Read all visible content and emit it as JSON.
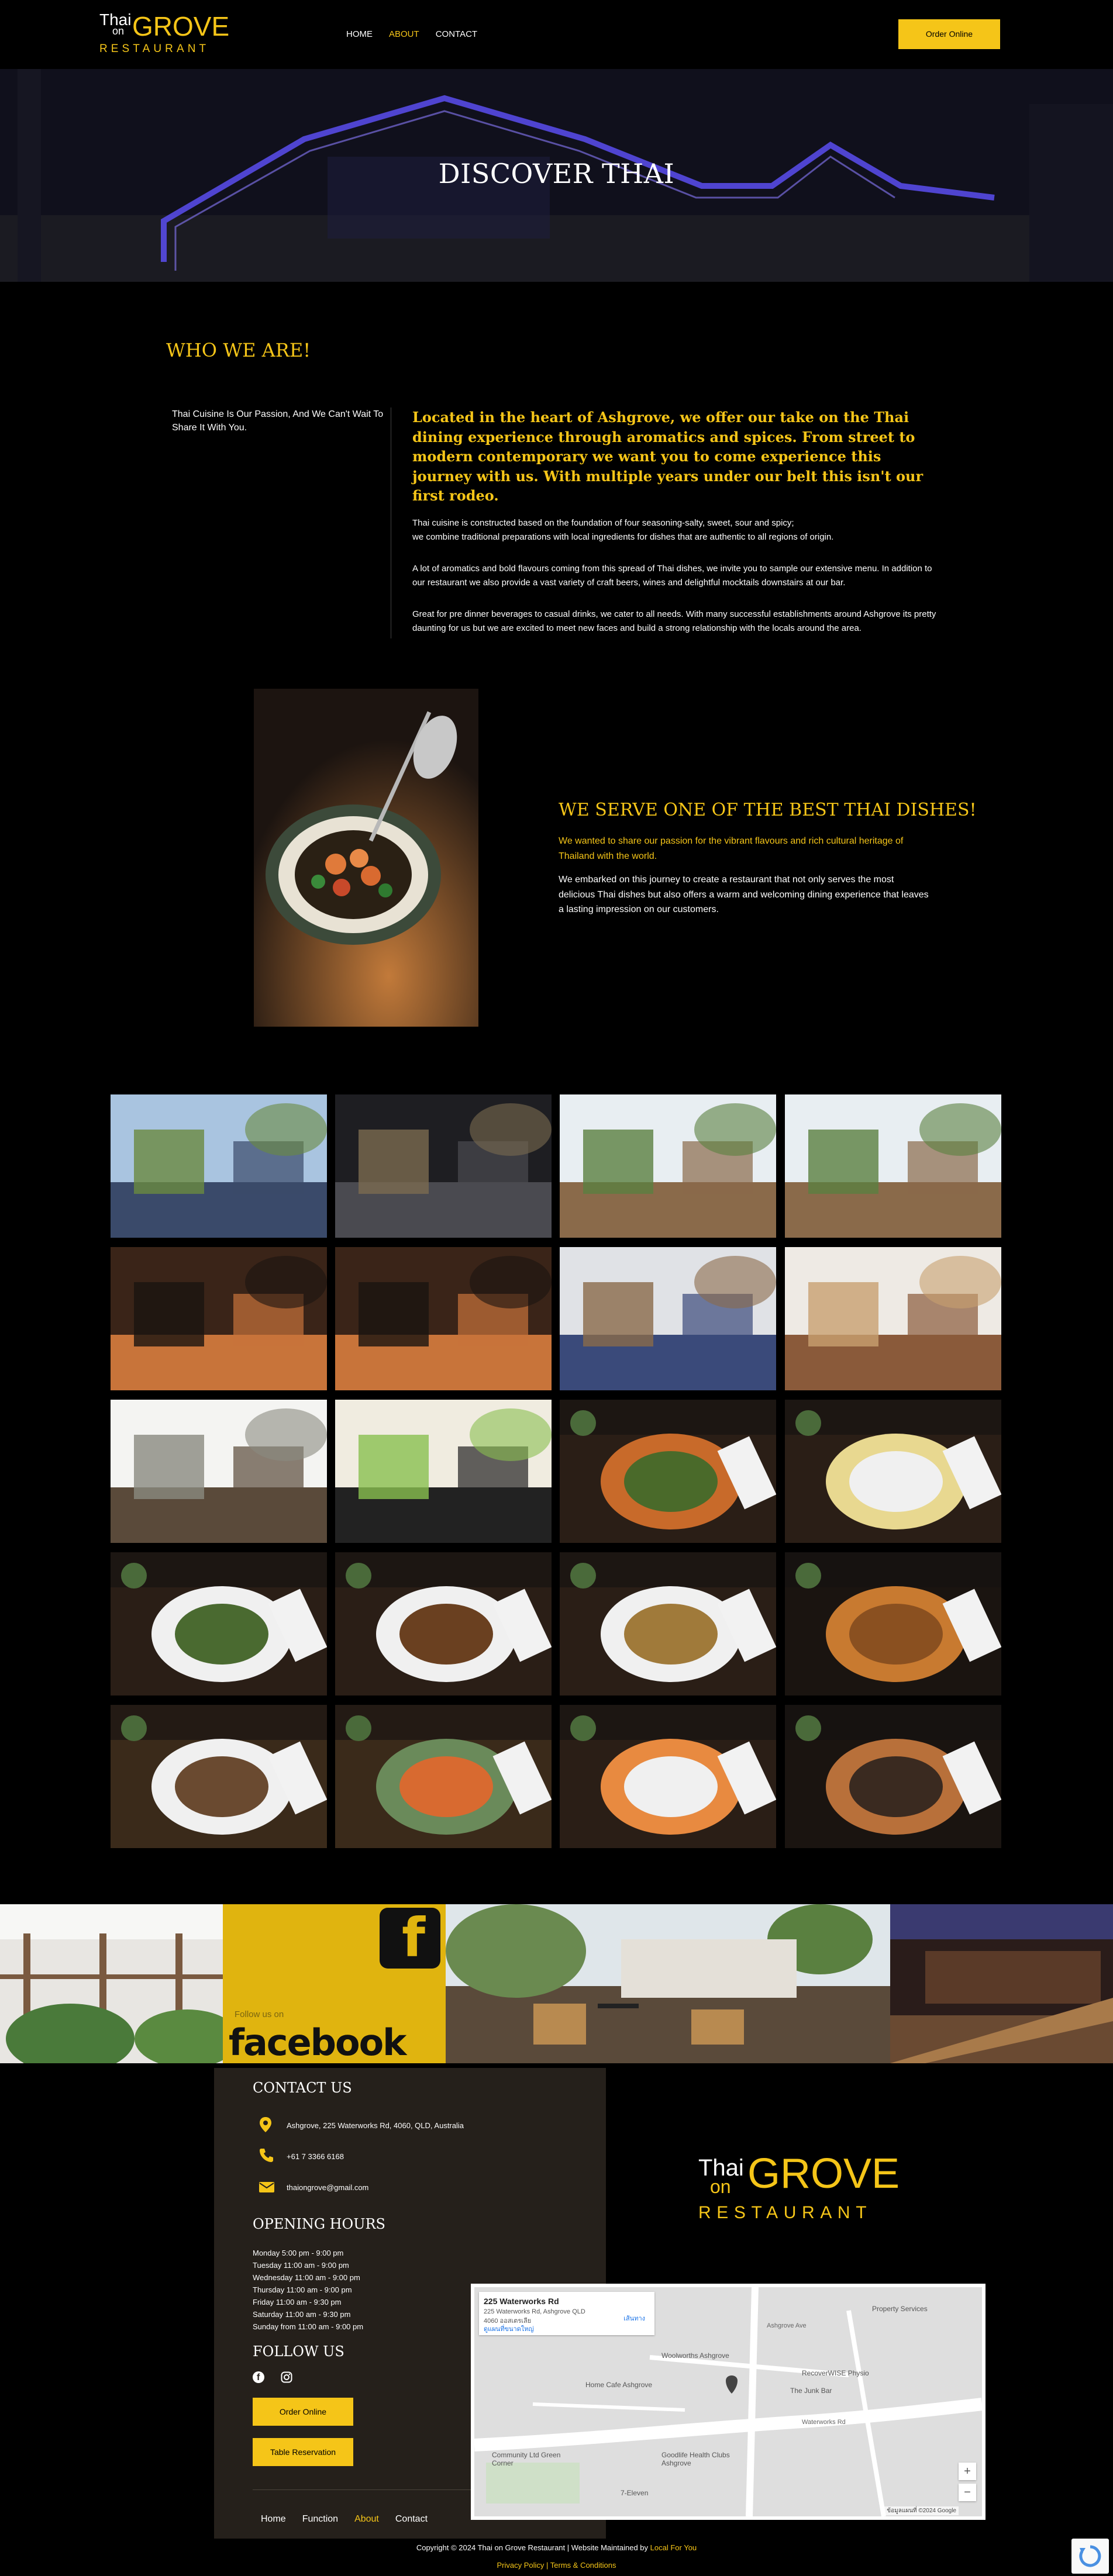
{
  "header": {
    "logo": {
      "line1": "Thai",
      "line2": "on",
      "brand": "GROVE",
      "tagline": "RESTAURANT"
    },
    "nav": [
      {
        "label": "HOME",
        "active": false
      },
      {
        "label": "ABOUT",
        "active": true
      },
      {
        "label": "CONTACT",
        "active": false
      }
    ],
    "order_button": "Order Online"
  },
  "hero": {
    "title": "DISCOVER THAI"
  },
  "who": {
    "title": "WHO WE ARE!",
    "tagline": "Thai Cuisine Is Our Passion, And We Can't Wait To Share It With You.",
    "lead": "Located in the heart of Ashgrove, we offer our take on the Thai dining experience through aromatics and spices. From street to modern contemporary we want you to come experience this journey with us. With multiple years under our belt this isn't our first rodeo.",
    "p1a": "Thai cuisine is constructed based on the foundation of four seasoning-salty, sweet, sour and spicy;",
    "p1b": "we combine traditional preparations with local ingredients for dishes that are authentic to all regions of origin.",
    "p2": "A lot of aromatics and bold flavours coming from this spread of Thai dishes, we invite you to sample our extensive menu. In addition to our restaurant we also provide a vast variety of craft beers, wines and delightful mocktails downstairs at our bar.",
    "p3": "Great for pre dinner beverages to casual drinks, we cater to all needs. With many successful establishments around Ashgrove its pretty daunting for us but we are excited to meet new faces and build a strong relationship with the locals around the area."
  },
  "best": {
    "title": "WE SERVE ONE OF THE BEST THAI DISHES!",
    "lead": "We wanted to share our passion for the vibrant flavours and rich cultural heritage of Thailand with the world.",
    "text": "We embarked on this journey to create a restaurant that not only serves the most delicious Thai dishes but also offers a warm and welcoming dining experience that leaves a lasting impression on our customers."
  },
  "gallery": [
    {
      "kind": "exterior-sky"
    },
    {
      "kind": "interior-dark"
    },
    {
      "kind": "patio-bright"
    },
    {
      "kind": "patio-bright"
    },
    {
      "kind": "dining-warm"
    },
    {
      "kind": "dining-warm"
    },
    {
      "kind": "dining-blue"
    },
    {
      "kind": "dining-light"
    },
    {
      "kind": "atrium-white"
    },
    {
      "kind": "wine-glasses"
    },
    {
      "kind": "curry-dish"
    },
    {
      "kind": "crepe-dish"
    },
    {
      "kind": "salad-dish"
    },
    {
      "kind": "duck-dish"
    },
    {
      "kind": "rice-dish"
    },
    {
      "kind": "platter-dish"
    },
    {
      "kind": "beef-salad"
    },
    {
      "kind": "noodle-dish"
    },
    {
      "kind": "soup-dish"
    },
    {
      "kind": "curry-bowl"
    }
  ],
  "facebook": {
    "follow_text": "Follow us on",
    "brand": "facebook"
  },
  "footer": {
    "contact_title": "CONTACT US",
    "address": "Ashgrove, 225 Waterworks Rd, 4060, QLD, Australia",
    "phone": "+61 7 3366 6168",
    "email": "thaiongrove@gmail.com",
    "hours_title": "OPENING HOURS",
    "hours": [
      "Monday 5:00 pm - 9:00 pm",
      "Tuesday 11:00 am - 9:00 pm",
      "Wednesday 11:00 am - 9:00 pm",
      "Thursday 11:00 am - 9:00 pm",
      "Friday 11:00 am - 9:30 pm",
      "Saturday 11:00 am - 9:30 pm",
      "Sunday from 11:00 am - 9:00 pm"
    ],
    "follow_title": "FOLLOW US",
    "order_button": "Order Online",
    "reserve_button": "Table Reservation",
    "nav": [
      {
        "label": "Home",
        "active": false
      },
      {
        "label": "Function",
        "active": false
      },
      {
        "label": "About",
        "active": true
      },
      {
        "label": "Contact",
        "active": false
      }
    ],
    "copyright": "Copyright © 2024 Thai on Grove Restaurant | Website Maintained by",
    "maintainer": "Local For You",
    "privacy": "Privacy Policy",
    "separator": " | ",
    "terms": "Terms & Conditions"
  },
  "map": {
    "place_title": "225 Waterworks Rd",
    "place_address": "225 Waterworks Rd, Ashgrove QLD 4060 ออสเตรเลีย",
    "directions_label": "เส้นทาง",
    "larger_map": "ดูแผนที่ขนาดใหญ่",
    "labels": [
      {
        "text": "Woolworths Ashgrove"
      },
      {
        "text": "RecoverWISE Physio"
      },
      {
        "text": "The Junk Bar"
      },
      {
        "text": "Home Cafe Ashgrove"
      },
      {
        "text": "Goodlife Health Clubs Ashgrove"
      },
      {
        "text": "Property Services"
      },
      {
        "text": "Waterworks Rd"
      },
      {
        "text": "7-Eleven"
      },
      {
        "text": "Community Ltd Green Corner"
      },
      {
        "text": "Ashgrove Ave"
      }
    ],
    "attribution": "ข้อมูลแผนที่ ©2024 Google"
  },
  "colors": {
    "accent": "#f5c518",
    "footer_panel": "#25201b"
  }
}
